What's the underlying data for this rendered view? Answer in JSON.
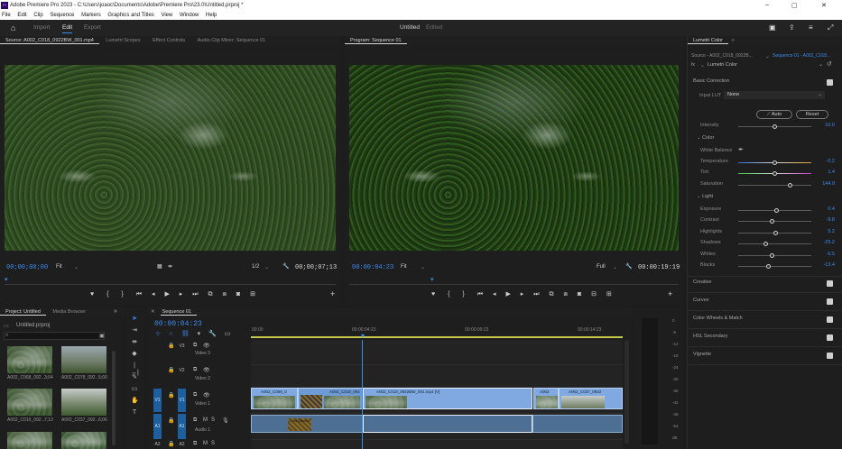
{
  "app": {
    "title": "Adobe Premiere Pro 2023 - C:\\Users\\joaoc\\Documents\\Adobe\\Premiere Pro\\23.0\\Untitled.prproj *",
    "window_buttons": [
      "–",
      "▢",
      "✕"
    ]
  },
  "menu": [
    "File",
    "Edit",
    "Clip",
    "Sequence",
    "Markers",
    "Graphics and Titles",
    "View",
    "Window",
    "Help"
  ],
  "workspace": {
    "tabs": [
      "Import",
      "Edit",
      "Export"
    ],
    "active": "Edit",
    "project_name": "Untitled",
    "project_status": "Edited"
  },
  "source_monitor": {
    "tabs": [
      "Source: A002_C018_0922BW_001.mp4",
      "Lumetri Scopes",
      "Effect Controls",
      "Audio Clip Mixer: Sequence 01"
    ],
    "timecode_in": "00;00;00;00",
    "fit": "Fit",
    "resolution": "1/2",
    "timecode_out": "00;00;07;13"
  },
  "program_monitor": {
    "tab": "Program: Sequence 01",
    "timecode_in": "00:00:04:23",
    "fit": "Fit",
    "resolution": "Full",
    "timecode_out": "00:00:19:19"
  },
  "project": {
    "tabs": [
      "Project: Untitled",
      "Media Browser"
    ],
    "file": "Untitled.prproj",
    "clips": [
      {
        "name": "A002_C068_092...",
        "duration": "3;04"
      },
      {
        "name": "A002_C078_092...",
        "duration": "5;00"
      },
      {
        "name": "A002_C010_092...",
        "duration": "7;13"
      },
      {
        "name": "A002_C037_092...",
        "duration": "6;06"
      }
    ]
  },
  "timeline": {
    "tab": "Sequence 01",
    "timecode": "00:00:04:23",
    "ruler": [
      "00:00",
      "00:00:04:23",
      "00:00:09:23",
      "00:00:14:23"
    ],
    "tracks": {
      "v3": "V3",
      "v2": "V2",
      "v1": "V1",
      "a1": "A1",
      "a2": "A2",
      "video3": "Video 3",
      "video2": "Video 2",
      "video1": "Video 1",
      "audio1": "Audio 1"
    },
    "video_clips": [
      "A002_C068_0",
      "A002_C018_092",
      "A002_C018_0922BW_001.mp4 [V]",
      "A002",
      "A002_C037_0922"
    ],
    "audio_clip_label": "Cross Dissolve"
  },
  "meter_labels": [
    "0",
    "-6",
    "-12",
    "-18",
    "-24",
    "-30",
    "-36",
    "-42",
    "-48",
    "-54",
    "dB"
  ],
  "lumetri": {
    "tab": "Lumetri Color",
    "source": "Source - A002_C018_0922B...",
    "sequence": "Sequence 01 - A002_C018...",
    "effect": "Lumetri Color",
    "fx": "fx",
    "basic_correction": "Basic Correction",
    "input_lut_label": "Input LUT",
    "input_lut_value": "None",
    "auto": "Auto",
    "reset": "Reset",
    "intensity": {
      "label": "Intensity",
      "value": "10.0",
      "pos": 0.5
    },
    "color_section": "Color",
    "white_balance": "White Balance",
    "temperature": {
      "label": "Temperature",
      "value": "-0.2",
      "pos": 0.5
    },
    "tint": {
      "label": "Tint",
      "value": "1.4",
      "pos": 0.5
    },
    "saturation": {
      "label": "Saturation",
      "value": "144.9",
      "pos": 0.72
    },
    "light_section": "Light",
    "exposure": {
      "label": "Exposure",
      "value": "0.4",
      "pos": 0.53
    },
    "contrast": {
      "label": "Contrast",
      "value": "-9.8",
      "pos": 0.47
    },
    "highlights": {
      "label": "Highlights",
      "value": "5.2",
      "pos": 0.52
    },
    "shadows": {
      "label": "Shadows",
      "value": "-25.2",
      "pos": 0.38
    },
    "whites": {
      "label": "Whites",
      "value": "-5.5",
      "pos": 0.47
    },
    "blacks": {
      "label": "Blacks",
      "value": "-13.4",
      "pos": 0.42
    },
    "sections": [
      "Creative",
      "Curves",
      "Color Wheels & Match",
      "HSL Secondary",
      "Vignette"
    ]
  },
  "colors": {
    "accent": "#3b8cf0",
    "clip_video": "#7fa9e0",
    "clip_audio": "#4c6f93"
  }
}
